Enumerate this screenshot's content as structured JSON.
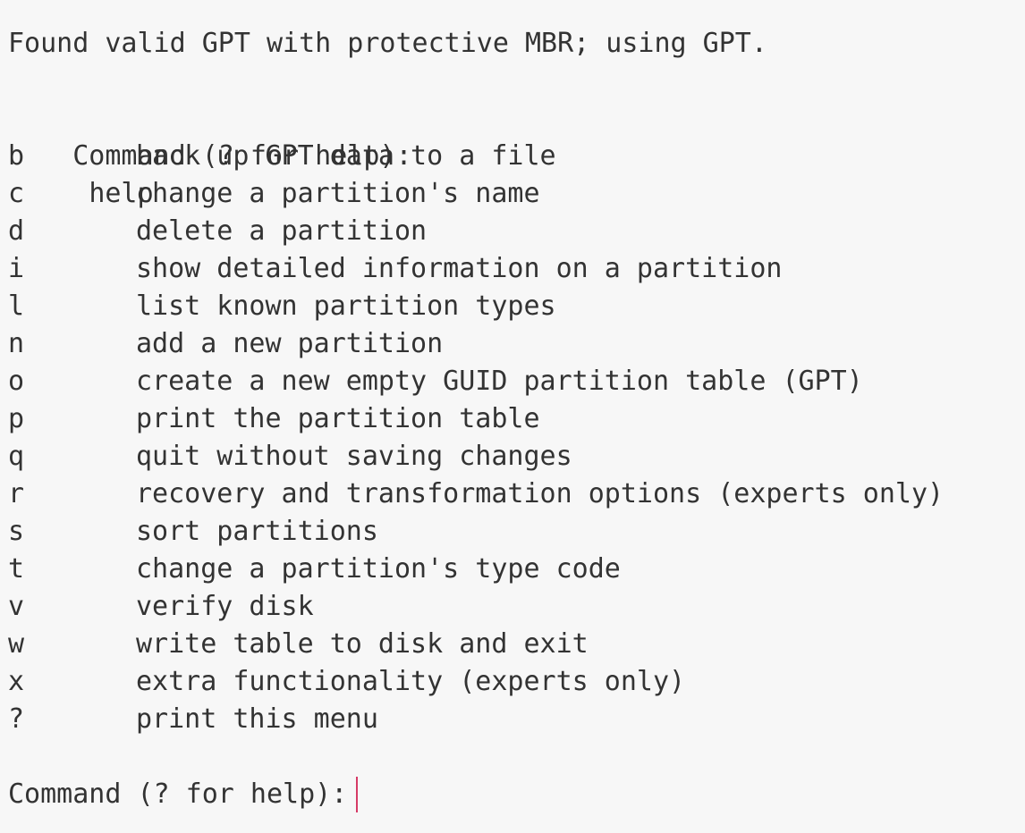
{
  "terminal": {
    "intro": "Found valid GPT with protective MBR; using GPT.",
    "first_prompt": {
      "prompt": "Command (? for help):",
      "input": "help"
    },
    "menu": [
      {
        "key": "b",
        "description": "back up GPT data to a file"
      },
      {
        "key": "c",
        "description": "change a partition's name"
      },
      {
        "key": "d",
        "description": "delete a partition"
      },
      {
        "key": "i",
        "description": "show detailed information on a partition"
      },
      {
        "key": "l",
        "description": "list known partition types"
      },
      {
        "key": "n",
        "description": "add a new partition"
      },
      {
        "key": "o",
        "description": "create a new empty GUID partition table (GPT)"
      },
      {
        "key": "p",
        "description": "print the partition table"
      },
      {
        "key": "q",
        "description": "quit without saving changes"
      },
      {
        "key": "r",
        "description": "recovery and transformation options (experts only)"
      },
      {
        "key": "s",
        "description": "sort partitions"
      },
      {
        "key": "t",
        "description": "change a partition's type code"
      },
      {
        "key": "v",
        "description": "verify disk"
      },
      {
        "key": "w",
        "description": "write table to disk and exit"
      },
      {
        "key": "x",
        "description": "extra functionality (experts only)"
      },
      {
        "key": "?",
        "description": "print this menu"
      }
    ],
    "current_prompt": {
      "prompt": "Command (? for help):",
      "input": ""
    },
    "cursor_color": "#d63a66"
  }
}
